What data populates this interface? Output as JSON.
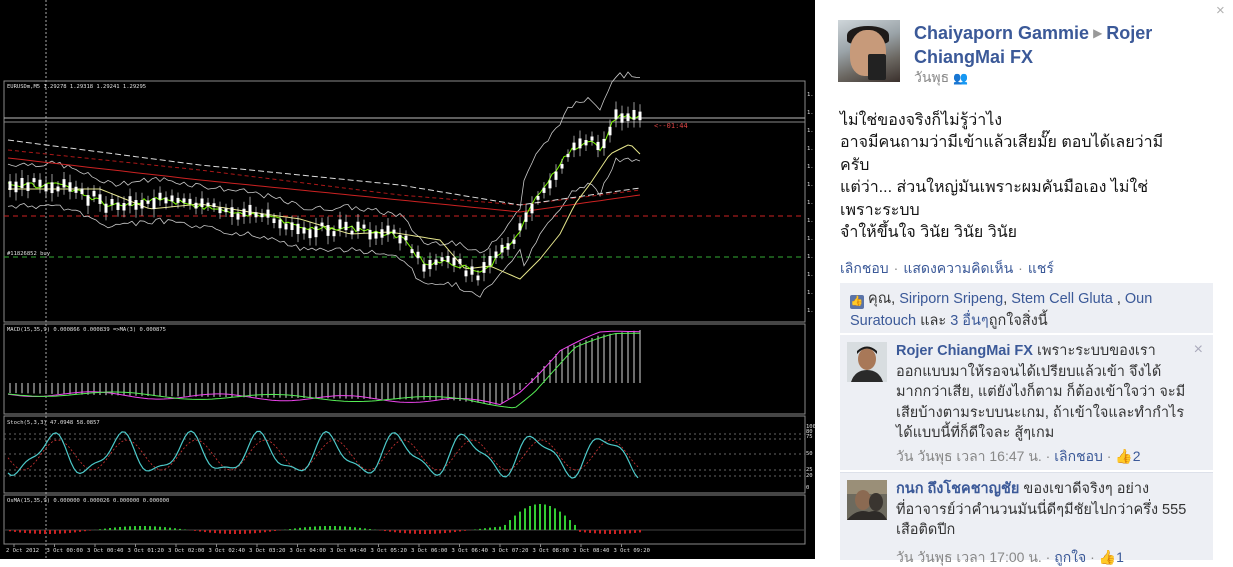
{
  "chart": {
    "symbol_label": "EURUSDm,M5  1.29278 1.29318 1.29241 1.29295",
    "timer_label": "<--01:44",
    "order_label": "#11826852 buy",
    "macd_label": "MACD(15,35,9) 0.000866 0.000839  =>MA(3) 0.000875",
    "stoch_label": "Stoch(5,3,3) 47.0948 58.0857",
    "osma_label": "OsMA(15,35,9) 0.000000 0.000026 0.000000 0.000000",
    "time_ticks": [
      "2 Oct 2012",
      "3 Oct 00:00",
      "3 Oct 00:40",
      "3 Oct 01:20",
      "3 Oct 02:00",
      "3 Oct 02:40",
      "3 Oct 03:20",
      "3 Oct 04:00",
      "3 Oct 04:40",
      "3 Oct 05:20",
      "3 Oct 06:00",
      "3 Oct 06:40",
      "3 Oct 07:20",
      "3 Oct 08:00",
      "3 Oct 08:40",
      "3 Oct 09:20"
    ],
    "stoch_scale": [
      "100",
      "80",
      "75",
      "50",
      "25",
      "20",
      "0"
    ],
    "price_scale": [
      "1.",
      "1.",
      "1.",
      "1.",
      "1.",
      "1.",
      "1.",
      "1.",
      "1.",
      "1.",
      "1.",
      "1.",
      "1."
    ],
    "colors": {
      "candle": "#ffffff",
      "bollinger": "#c8c8c8",
      "ma_fast": "#7cfc00",
      "ma_slow": "#e6e68c",
      "ma_red": "#cc2222",
      "macd_line": "#ee44ee",
      "macd_signal": "#55ee55",
      "stoch": "#4cc9c9",
      "stoch_signal": "#cc3333",
      "osma_pos": "#33cc33",
      "osma_neg": "#cc2222"
    }
  },
  "post": {
    "close": "×",
    "author": "Chaiyaporn Gammie",
    "target": "Rojer ChiangMai FX",
    "time": "วันพุธ",
    "body_lines": [
      "ไม่ใช่ของจริงก็ไม่รู้ว่าไง",
      "อาจมีคนถามว่ามีเข้าแล้วเสียมั๊ย ตอบได้เลยว่ามี",
      "ครับ",
      "แต่ว่า... ส่วนใหญ่มันเพราะผมคันมือเอง ไม่ใช่",
      "เพราะระบบ",
      "จำให้ขึ้นใจ วินัย วินัย วินัย"
    ],
    "actions": [
      "เลิกชอบ",
      "แสดงความคิดเห็น",
      "แชร์"
    ],
    "likes": {
      "you": "คุณ,",
      "names": [
        "Siriporn Sripeng",
        "Stem Cell Gluta",
        "Oun Suratouch"
      ],
      "and": "และ",
      "others": "3 อื่นๆ",
      "tail": "ถูกใจสิ่งนี้"
    }
  },
  "comments": [
    {
      "name": "Rojer ChiangMai FX",
      "lines": [
        "เพราะระบบของเรา",
        "ออกแบบมาให้รอจนได้เปรียบแล้วเข้า จึงได้",
        "มากกว่าเสีย, แต่ยังไงก็ตาม ก็ต้องเข้าใจว่า จะมี",
        "เสียบ้างตามระบบนะเกม, ถ้าเข้าใจและทำกำไร",
        "ได้แบบนี้ที่ก็ดีใจละ สู้ๆเกม"
      ],
      "time": "วัน วันพุธ เวลา 16:47 น.",
      "action": "เลิกชอบ",
      "like_count": "2",
      "close": "×"
    },
    {
      "name": "กนก ถึงโชคชาญชัย",
      "lines": [
        "ของเขาดีจริงๆ อย่าง",
        "ที่อาจารย์ว่าคำนวนมันนี่ดีๆมีชัยไปกว่าครึ่ง 555",
        "เสือติดปีก"
      ],
      "time": "วัน วันพุธ เวลา 17:00 น.",
      "action": "ถูกใจ",
      "like_count": "1"
    }
  ]
}
